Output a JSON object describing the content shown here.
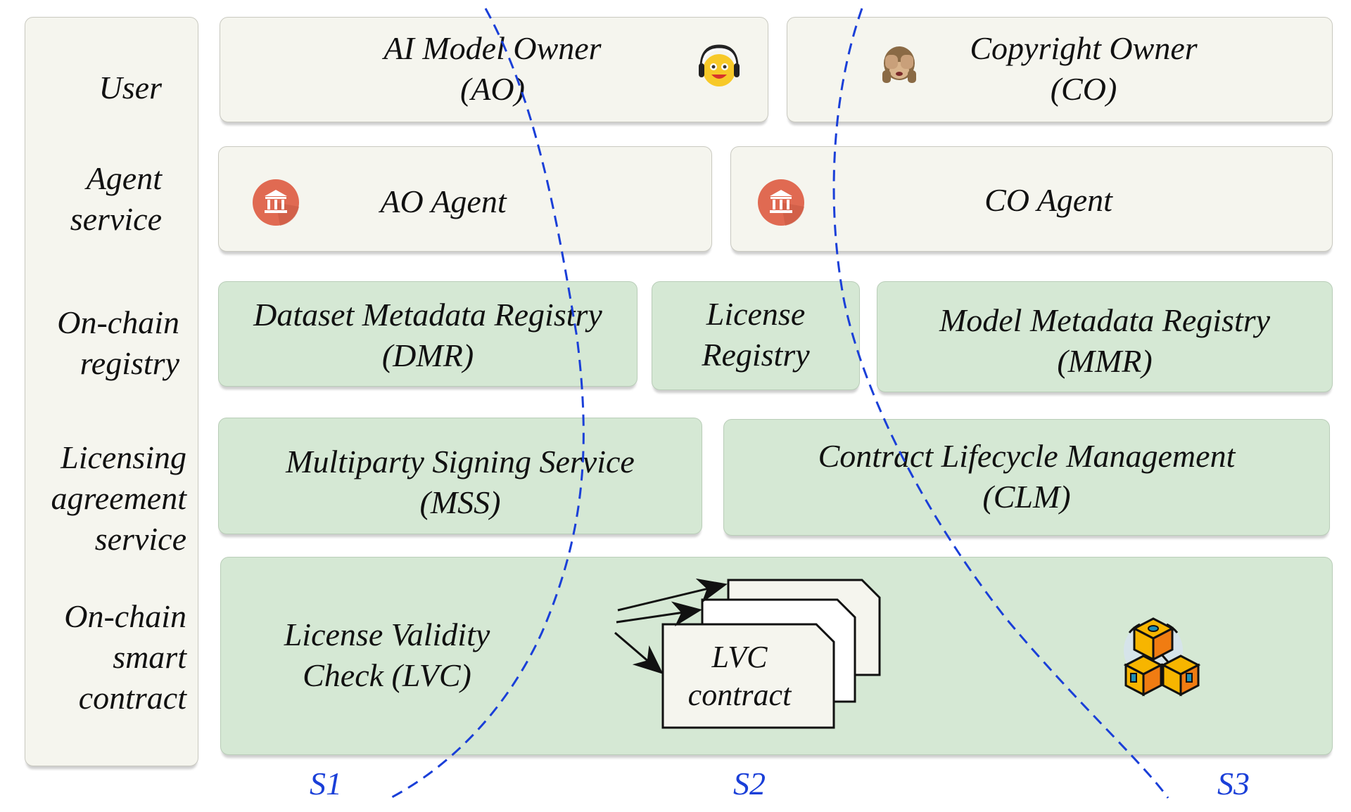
{
  "layers": [
    {
      "id": "user",
      "lines": [
        "User"
      ]
    },
    {
      "id": "agent",
      "lines": [
        "Agent",
        "service"
      ]
    },
    {
      "id": "registry",
      "lines": [
        "On-chain",
        "registry"
      ]
    },
    {
      "id": "licensing",
      "lines": [
        "Licensing",
        "agreement",
        "service"
      ]
    },
    {
      "id": "contract",
      "lines": [
        "On-chain",
        "smart",
        "contract"
      ]
    }
  ],
  "users": {
    "ao": {
      "lines": [
        "AI Model Owner",
        "(AO)"
      ],
      "icon": "headphones-smiley-icon"
    },
    "co": {
      "lines": [
        "Copyright Owner",
        "(CO)"
      ],
      "icon": "see-no-evil-monkey-icon"
    }
  },
  "agents": {
    "ao": {
      "label": "AO Agent",
      "icon": "bank-icon"
    },
    "co": {
      "label": "CO Agent",
      "icon": "bank-icon"
    }
  },
  "registries": {
    "dmr": {
      "lines": [
        "Dataset Metadata Registry",
        "(DMR)"
      ]
    },
    "license": {
      "lines": [
        "License",
        "Registry"
      ]
    },
    "mmr": {
      "lines": [
        "Model Metadata Registry",
        "(MMR)"
      ]
    }
  },
  "services": {
    "mss": {
      "lines": [
        "Multiparty Signing Service",
        "(MSS)"
      ]
    },
    "clm": {
      "lines": [
        "Contract Lifecycle Management",
        "(CLM)"
      ]
    }
  },
  "smart_contract": {
    "lvc": {
      "lines": [
        "License Validity",
        "Check (LVC)"
      ]
    },
    "lvc_contract": {
      "lines": [
        "LVC",
        "contract"
      ]
    },
    "blockchain_icon": "blockchain-cubes-icon"
  },
  "scenarios": [
    "S1",
    "S2",
    "S3"
  ],
  "colors": {
    "cream": "#f5f5ee",
    "green": "#d5e8d4",
    "dash": "#1a3fd8",
    "bank": "#e06a52",
    "cube_light": "#f7b500",
    "cube_dark": "#f07c12"
  }
}
